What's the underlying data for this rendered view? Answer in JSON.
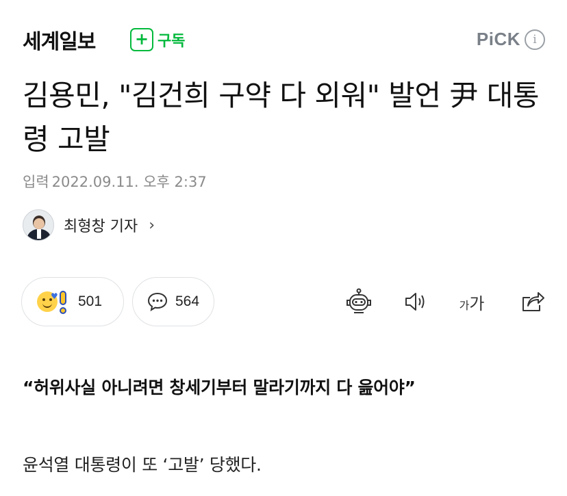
{
  "header": {
    "press_name": "세계일보",
    "subscribe_icon": "+",
    "subscribe_label": "구독",
    "pick_label": "PiCK",
    "info_icon": "i"
  },
  "article": {
    "title": "김용민, \"김건희 구약 다 외워\" 발언 尹 대통령 고발",
    "date_label": "입력",
    "date_value": "2022.09.11. 오후 2:37",
    "reporter_name": "최형창 기자",
    "reporter_chevron": "›",
    "subtitle": "“허위사실 아니려면 창세기부터 말라기까지 다 읊어야”",
    "body_first_line": "윤석열 대통령이 또 ‘고발’ 당했다."
  },
  "actions": {
    "reaction_count": "501",
    "comment_count": "564",
    "font_small": "가",
    "font_large": "가"
  },
  "icons": {
    "reaction": "smile-exclaim-emoji-icon",
    "comment": "speech-bubble-icon",
    "summary": "robot-icon",
    "tts": "speaker-icon",
    "font": "font-size-icon",
    "share": "share-icon"
  },
  "colors": {
    "subscribe_green": "#03b93c",
    "pick_gray": "#7a8088",
    "meta_gray": "#8a8a8a"
  }
}
